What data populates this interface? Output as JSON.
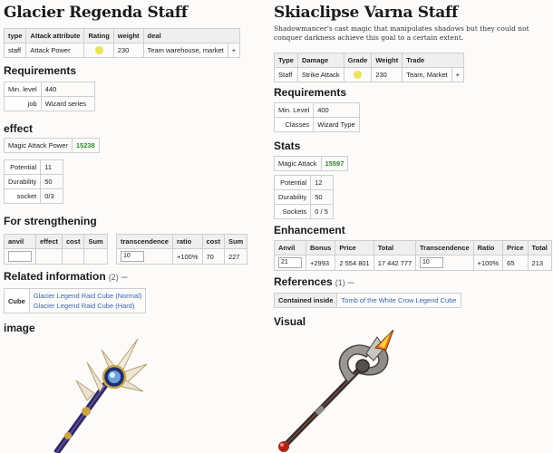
{
  "left": {
    "title": "Glacier Regenda Staff",
    "top_table": {
      "headers": [
        "type",
        "Attack attribute",
        "Rating",
        "weight",
        "deal"
      ],
      "values": [
        "staff",
        "Attack Power",
        "",
        "230",
        "Team warehouse, market"
      ],
      "plus": "+"
    },
    "requirements_heading": "Requirements",
    "requirements": [
      {
        "label": "Min. level",
        "value": "440"
      },
      {
        "label": "job",
        "value": "Wizard series"
      }
    ],
    "effect_heading": "effect",
    "effect": {
      "label": "Magic Attack Power",
      "value": "15238"
    },
    "stats": [
      {
        "label": "Potential",
        "value": "11"
      },
      {
        "label": "Durability",
        "value": "50"
      },
      {
        "label": "socket",
        "value": "0/3"
      }
    ],
    "strengthening_heading": "For strengthening",
    "anvil_table": {
      "headers": [
        "anvil",
        "effect",
        "cost",
        "Sum"
      ],
      "anvil_value": ""
    },
    "transcendence_table": {
      "headers": [
        "transcendence",
        "ratio",
        "cost",
        "Sum"
      ],
      "values": [
        "10",
        "+100%",
        "70",
        "227"
      ]
    },
    "related_heading": "Related information",
    "related_count": "(2)",
    "related_dash": "–",
    "related": {
      "label": "Cube",
      "links": [
        "Glacier Legend Raid Cube (Normal)",
        "Glacier Legend Raid Cube (Hard)"
      ]
    },
    "image_heading": "image"
  },
  "right": {
    "title": "Skiaclipse Varna Staff",
    "description": "Shadowmancer's cast magic that manipulates shadows but they could not conquer darkness achieve this goal to a certain extent.",
    "top_table": {
      "headers": [
        "Type",
        "Damage",
        "Grade",
        "Weight",
        "Trade"
      ],
      "values": [
        "Staff",
        "Strike Attack",
        "",
        "230",
        "Team, Market"
      ],
      "plus": "+"
    },
    "requirements_heading": "Requirements",
    "requirements": [
      {
        "label": "Min. Level",
        "value": "400"
      },
      {
        "label": "Classes",
        "value": "Wizard Type"
      }
    ],
    "stats_heading": "Stats",
    "magic": {
      "label": "Magic Attack",
      "value": "15597"
    },
    "stats": [
      {
        "label": "Potential",
        "value": "12"
      },
      {
        "label": "Durability",
        "value": "50"
      },
      {
        "label": "Sockets",
        "value": "0 / 5"
      }
    ],
    "enhancement_heading": "Enhancement",
    "anvil_table": {
      "headers": [
        "Anvil",
        "Bonus",
        "Price",
        "Total"
      ],
      "values": [
        "21",
        "+2993",
        "2 554 801",
        "17 442 777"
      ]
    },
    "transcendence_table": {
      "headers": [
        "Transcendence",
        "Ratio",
        "Price",
        "Total"
      ],
      "values": [
        "10",
        "+100%",
        "65",
        "213"
      ]
    },
    "references_heading": "References",
    "references_count": "(1)",
    "references_dash": "–",
    "references": {
      "label": "Contained inside",
      "link": "Tomb of the White Crow Legend Cube"
    },
    "visual_heading": "Visual"
  },
  "colors": {
    "accent_green": "#2a8a2a",
    "link_blue": "#3767b0",
    "rating_yellow": "#ece35c"
  }
}
